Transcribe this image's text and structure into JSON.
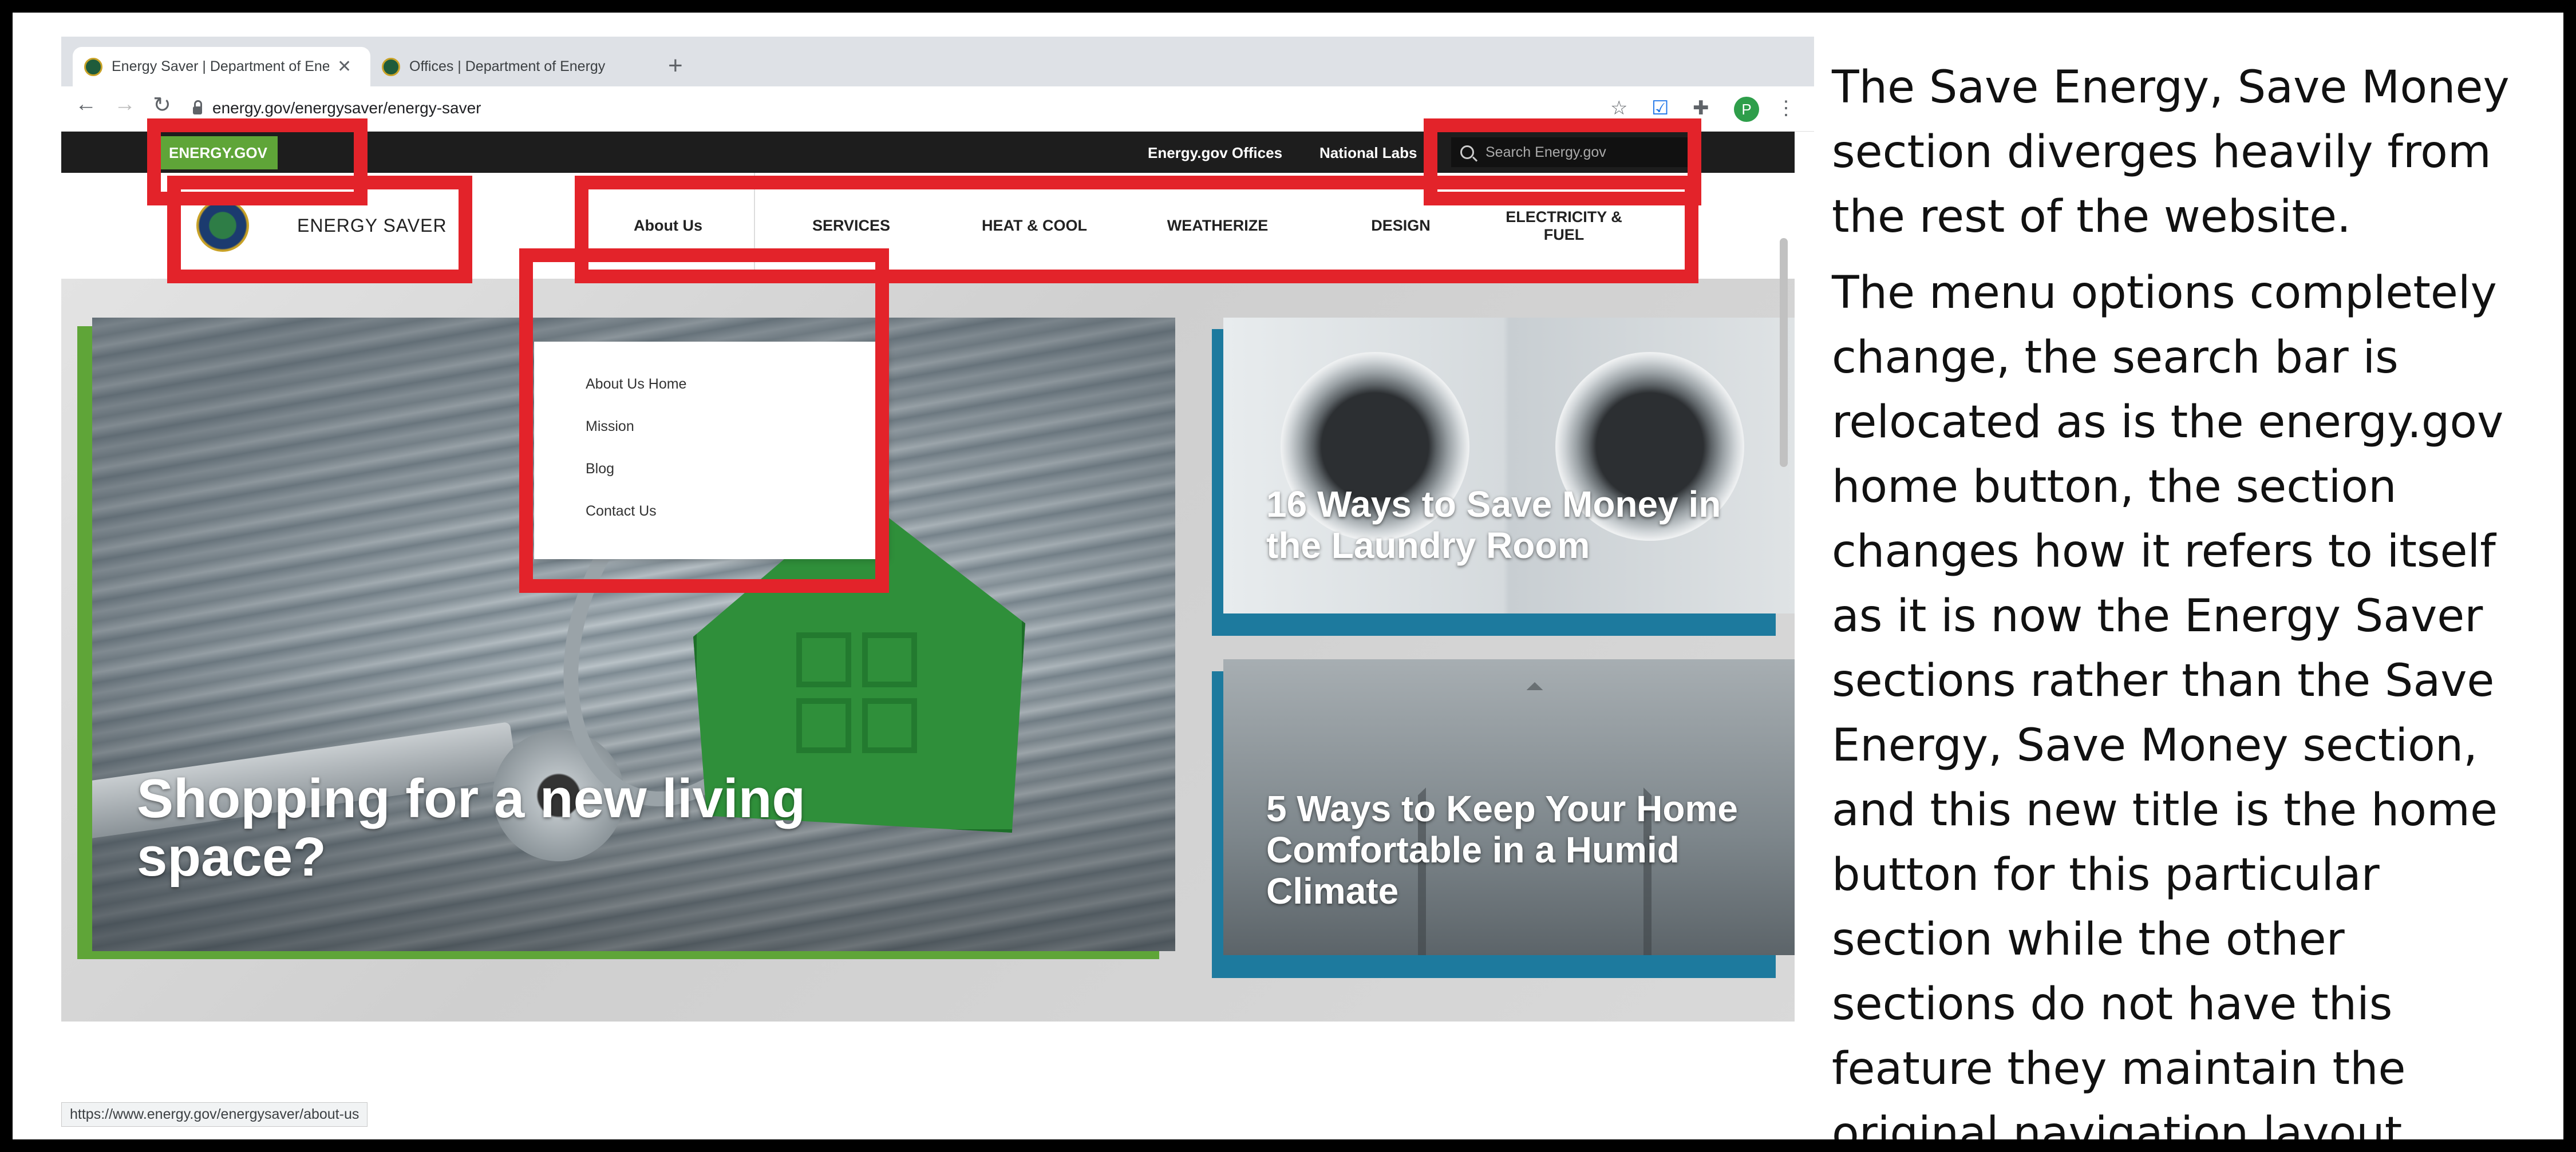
{
  "browser": {
    "tabs": [
      {
        "title": "Energy Saver | Department of Energy",
        "active": true
      },
      {
        "title": "Offices | Department of Energy",
        "active": false
      }
    ],
    "new_tab": "+",
    "url": "energy.gov/energysaver/energy-saver",
    "profile_initial": "P",
    "status_url": "https://www.energy.gov/energysaver/about-us"
  },
  "site": {
    "home_badge": "ENERGY.GOV",
    "top_links": [
      "Energy.gov Offices",
      "National Labs"
    ],
    "search_placeholder": "Search Energy.gov",
    "site_title": "ENERGY SAVER",
    "menu": [
      "About Us",
      "SERVICES",
      "HEAT & COOL",
      "WEATHERIZE",
      "DESIGN",
      "ELECTRICITY & FUEL"
    ],
    "dropdown": [
      "About Us Home",
      "Mission",
      "Blog",
      "Contact Us"
    ],
    "hero": {
      "title": "Shopping for a new living space?"
    },
    "cards": [
      {
        "title": "16 Ways to Save Money in the Laundry Room"
      },
      {
        "title": "5 Ways to Keep Your Home Comfortable in a Humid Climate"
      }
    ]
  },
  "annotation": {
    "paragraphs": [
      "The Save Energy, Save Money section diverges heavily from the rest of the website.",
      "The menu options completely change, the search bar is relocated as is the energy.gov home button, the section changes how it refers to itself as it is now the Energy Saver sections rather than the Save Energy, Save Money section, and this new title is the home button for this particular section while the other sections do not have this feature they maintain the original navigation layout."
    ]
  },
  "colors": {
    "highlight": "#e3232a",
    "brand_green": "#5fa538",
    "card_blue": "#1d7a9e",
    "top_bar": "#1d1d1d"
  },
  "icons": [
    "lock-icon",
    "star-icon",
    "extension-icon",
    "puzzle-icon",
    "search-icon",
    "kebab-menu-icon",
    "back-arrow-icon",
    "forward-arrow-icon",
    "reload-icon",
    "close-icon",
    "doe-seal-icon"
  ]
}
